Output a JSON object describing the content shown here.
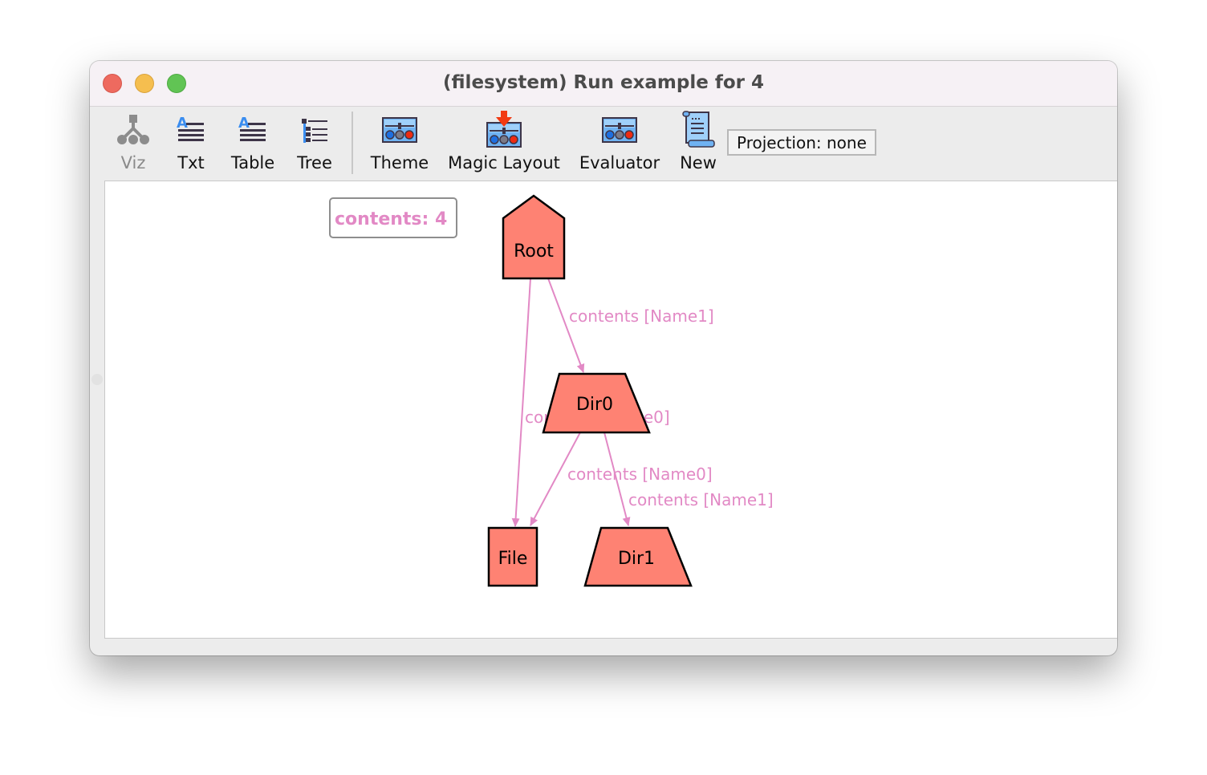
{
  "window": {
    "title": "(filesystem) Run example for 4"
  },
  "toolbar": {
    "buttons": [
      {
        "label": "Viz",
        "icon": "viz-tree-icon",
        "enabled": false
      },
      {
        "label": "Txt",
        "icon": "text-icon",
        "enabled": true
      },
      {
        "label": "Table",
        "icon": "table-icon",
        "enabled": true
      },
      {
        "label": "Tree",
        "icon": "tree-icon",
        "enabled": true
      },
      {
        "label": "Theme",
        "icon": "theme-sliders-icon",
        "enabled": true
      },
      {
        "label": "Magic Layout",
        "icon": "magic-layout-icon",
        "enabled": true
      },
      {
        "label": "Evaluator",
        "icon": "evaluator-sliders-icon",
        "enabled": true
      },
      {
        "label": "New",
        "icon": "scroll-icon",
        "enabled": true
      }
    ],
    "projection_label": "Projection: none"
  },
  "graph": {
    "count_box": "contents: 4",
    "node_fill": "#fe8273",
    "edge_color": "#e289c5",
    "nodes": [
      {
        "id": "root",
        "label": "Root",
        "shape": "house"
      },
      {
        "id": "dir0",
        "label": "Dir0",
        "shape": "trapezium"
      },
      {
        "id": "file",
        "label": "File",
        "shape": "box"
      },
      {
        "id": "dir1",
        "label": "Dir1",
        "shape": "trapezium"
      }
    ],
    "edges": [
      {
        "from": "Root",
        "to": "Dir0",
        "label": "contents [Name1]"
      },
      {
        "from": "Root",
        "to": "File",
        "label": "contents [Name0]"
      },
      {
        "from": "Dir0",
        "to": "File",
        "label": "contents [Name0]"
      },
      {
        "from": "Dir0",
        "to": "Dir1",
        "label": "contents [Name1]"
      }
    ]
  }
}
